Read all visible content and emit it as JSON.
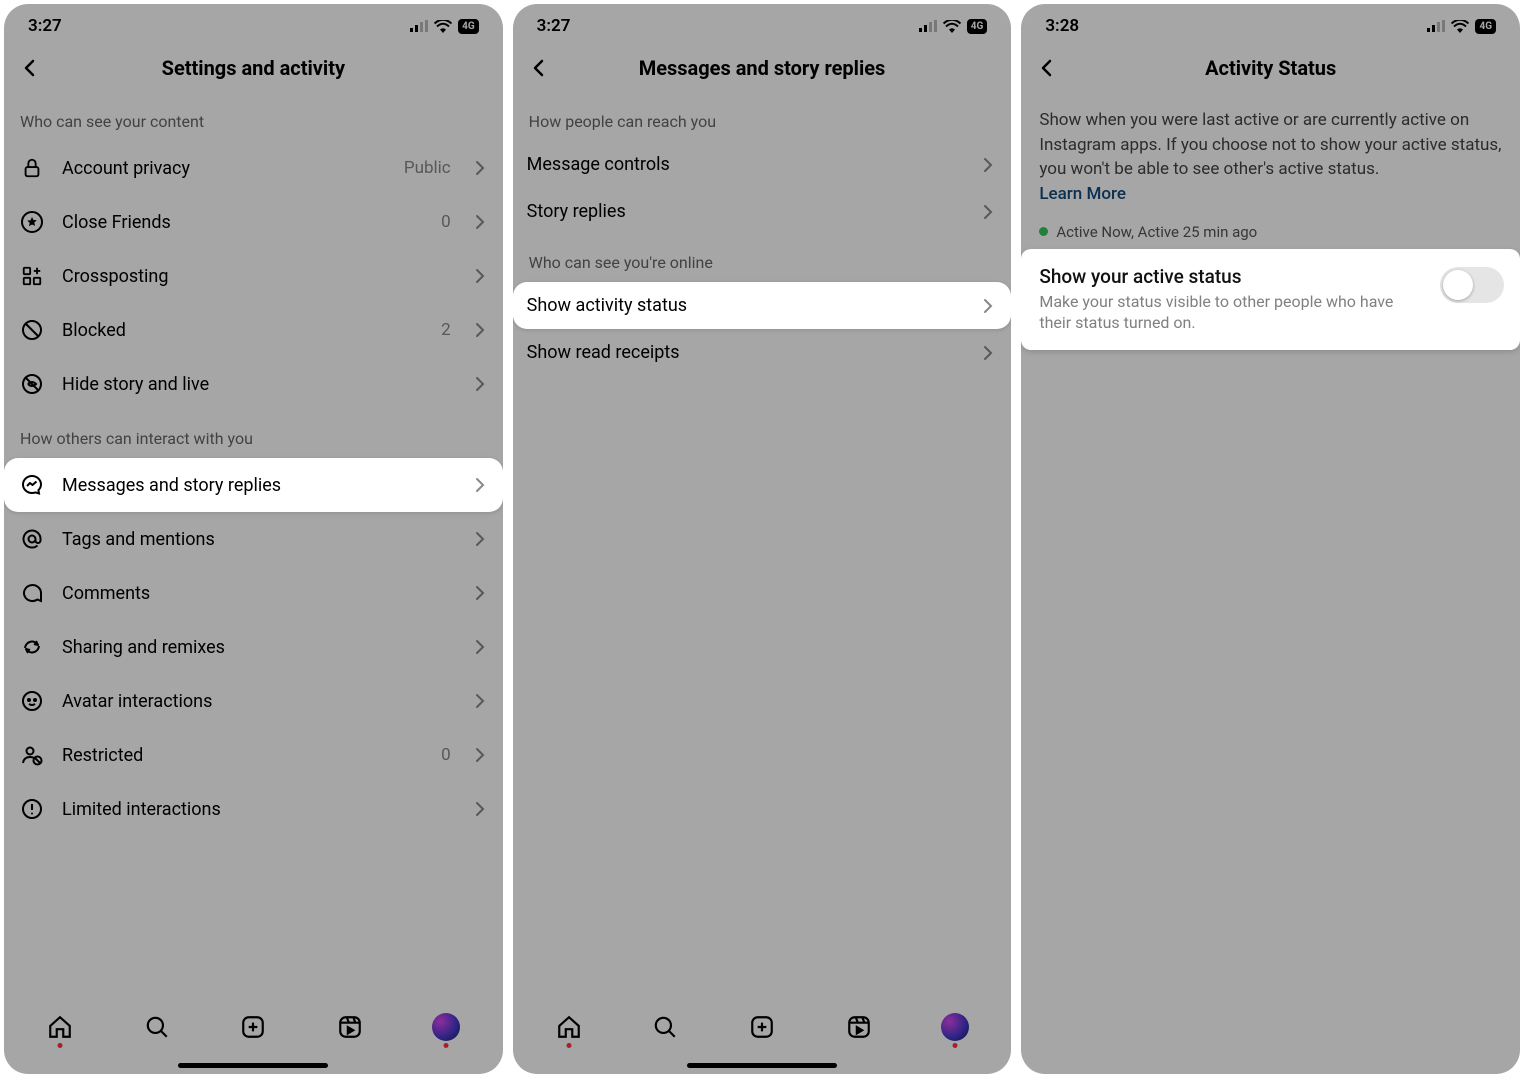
{
  "screen1": {
    "time": "3:27",
    "network_badge": "4G",
    "title": "Settings and activity",
    "section1": "Who can see your content",
    "items1": [
      {
        "icon": "lock-icon",
        "label": "Account privacy",
        "trailing": "Public"
      },
      {
        "icon": "star-circle-icon",
        "label": "Close Friends",
        "trailing": "0"
      },
      {
        "icon": "grid-plus-icon",
        "label": "Crossposting",
        "trailing": ""
      },
      {
        "icon": "no-symbol-icon",
        "label": "Blocked",
        "trailing": "2"
      },
      {
        "icon": "hide-icon",
        "label": "Hide story and live",
        "trailing": ""
      }
    ],
    "section2": "How others can interact with you",
    "items2": [
      {
        "icon": "messenger-icon",
        "label": "Messages and story replies",
        "trailing": "",
        "highlight": true
      },
      {
        "icon": "at-icon",
        "label": "Tags and mentions",
        "trailing": ""
      },
      {
        "icon": "comment-icon",
        "label": "Comments",
        "trailing": ""
      },
      {
        "icon": "remix-icon",
        "label": "Sharing and remixes",
        "trailing": ""
      },
      {
        "icon": "avatar-head-icon",
        "label": "Avatar interactions",
        "trailing": ""
      },
      {
        "icon": "restricted-icon",
        "label": "Restricted",
        "trailing": "0"
      },
      {
        "icon": "exclamation-circle-icon",
        "label": "Limited interactions",
        "trailing": ""
      }
    ]
  },
  "screen2": {
    "time": "3:27",
    "network_badge": "4G",
    "title": "Messages and story replies",
    "section1": "How people can reach you",
    "items1": [
      {
        "label": "Message controls"
      },
      {
        "label": "Story replies"
      }
    ],
    "section2": "Who can see you're online",
    "items2": [
      {
        "label": "Show activity status",
        "highlight": true
      },
      {
        "label": "Show read receipts"
      }
    ]
  },
  "screen3": {
    "time": "3:28",
    "network_badge": "4G",
    "title": "Activity Status",
    "description": "Show when you were last active or are currently active on Instagram apps. If you choose not to show your active status, you won't be able to see other's active status.",
    "learn_more": "Learn More",
    "active_line": "Active Now, Active 25 min ago",
    "toggle": {
      "title": "Show your active status",
      "subtitle": "Make your status visible to other people who have their status turned on.",
      "on": false
    }
  }
}
